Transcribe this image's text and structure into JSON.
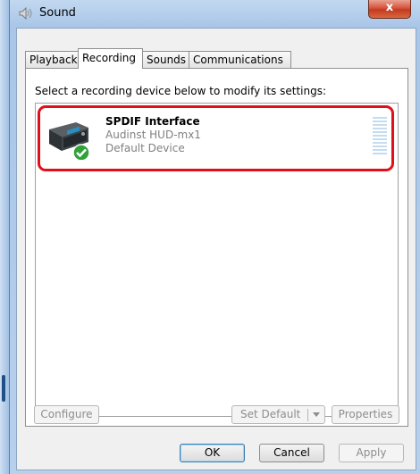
{
  "window": {
    "title": "Sound",
    "close_glyph": "x"
  },
  "tabs": [
    {
      "label": "Playback"
    },
    {
      "label": "Recording"
    },
    {
      "label": "Sounds"
    },
    {
      "label": "Communications"
    }
  ],
  "active_tab": "Recording",
  "panel": {
    "instruction": "Select a recording device below to modify its settings:",
    "devices": [
      {
        "name": "SPDIF Interface",
        "subtitle": "Audinst HUD-mx1",
        "status": "Default Device",
        "icon": "audio-interface-icon",
        "badge": "default-checkmark-icon",
        "selected": true
      }
    ],
    "buttons": {
      "configure": "Configure",
      "set_default": "Set Default",
      "properties": "Properties"
    }
  },
  "dialog_buttons": {
    "ok": "OK",
    "cancel": "Cancel",
    "apply": "Apply"
  },
  "colors": {
    "selection_border": "#e0101a",
    "title_bar": "#a9c6e8",
    "close_button": "#c23a22"
  }
}
